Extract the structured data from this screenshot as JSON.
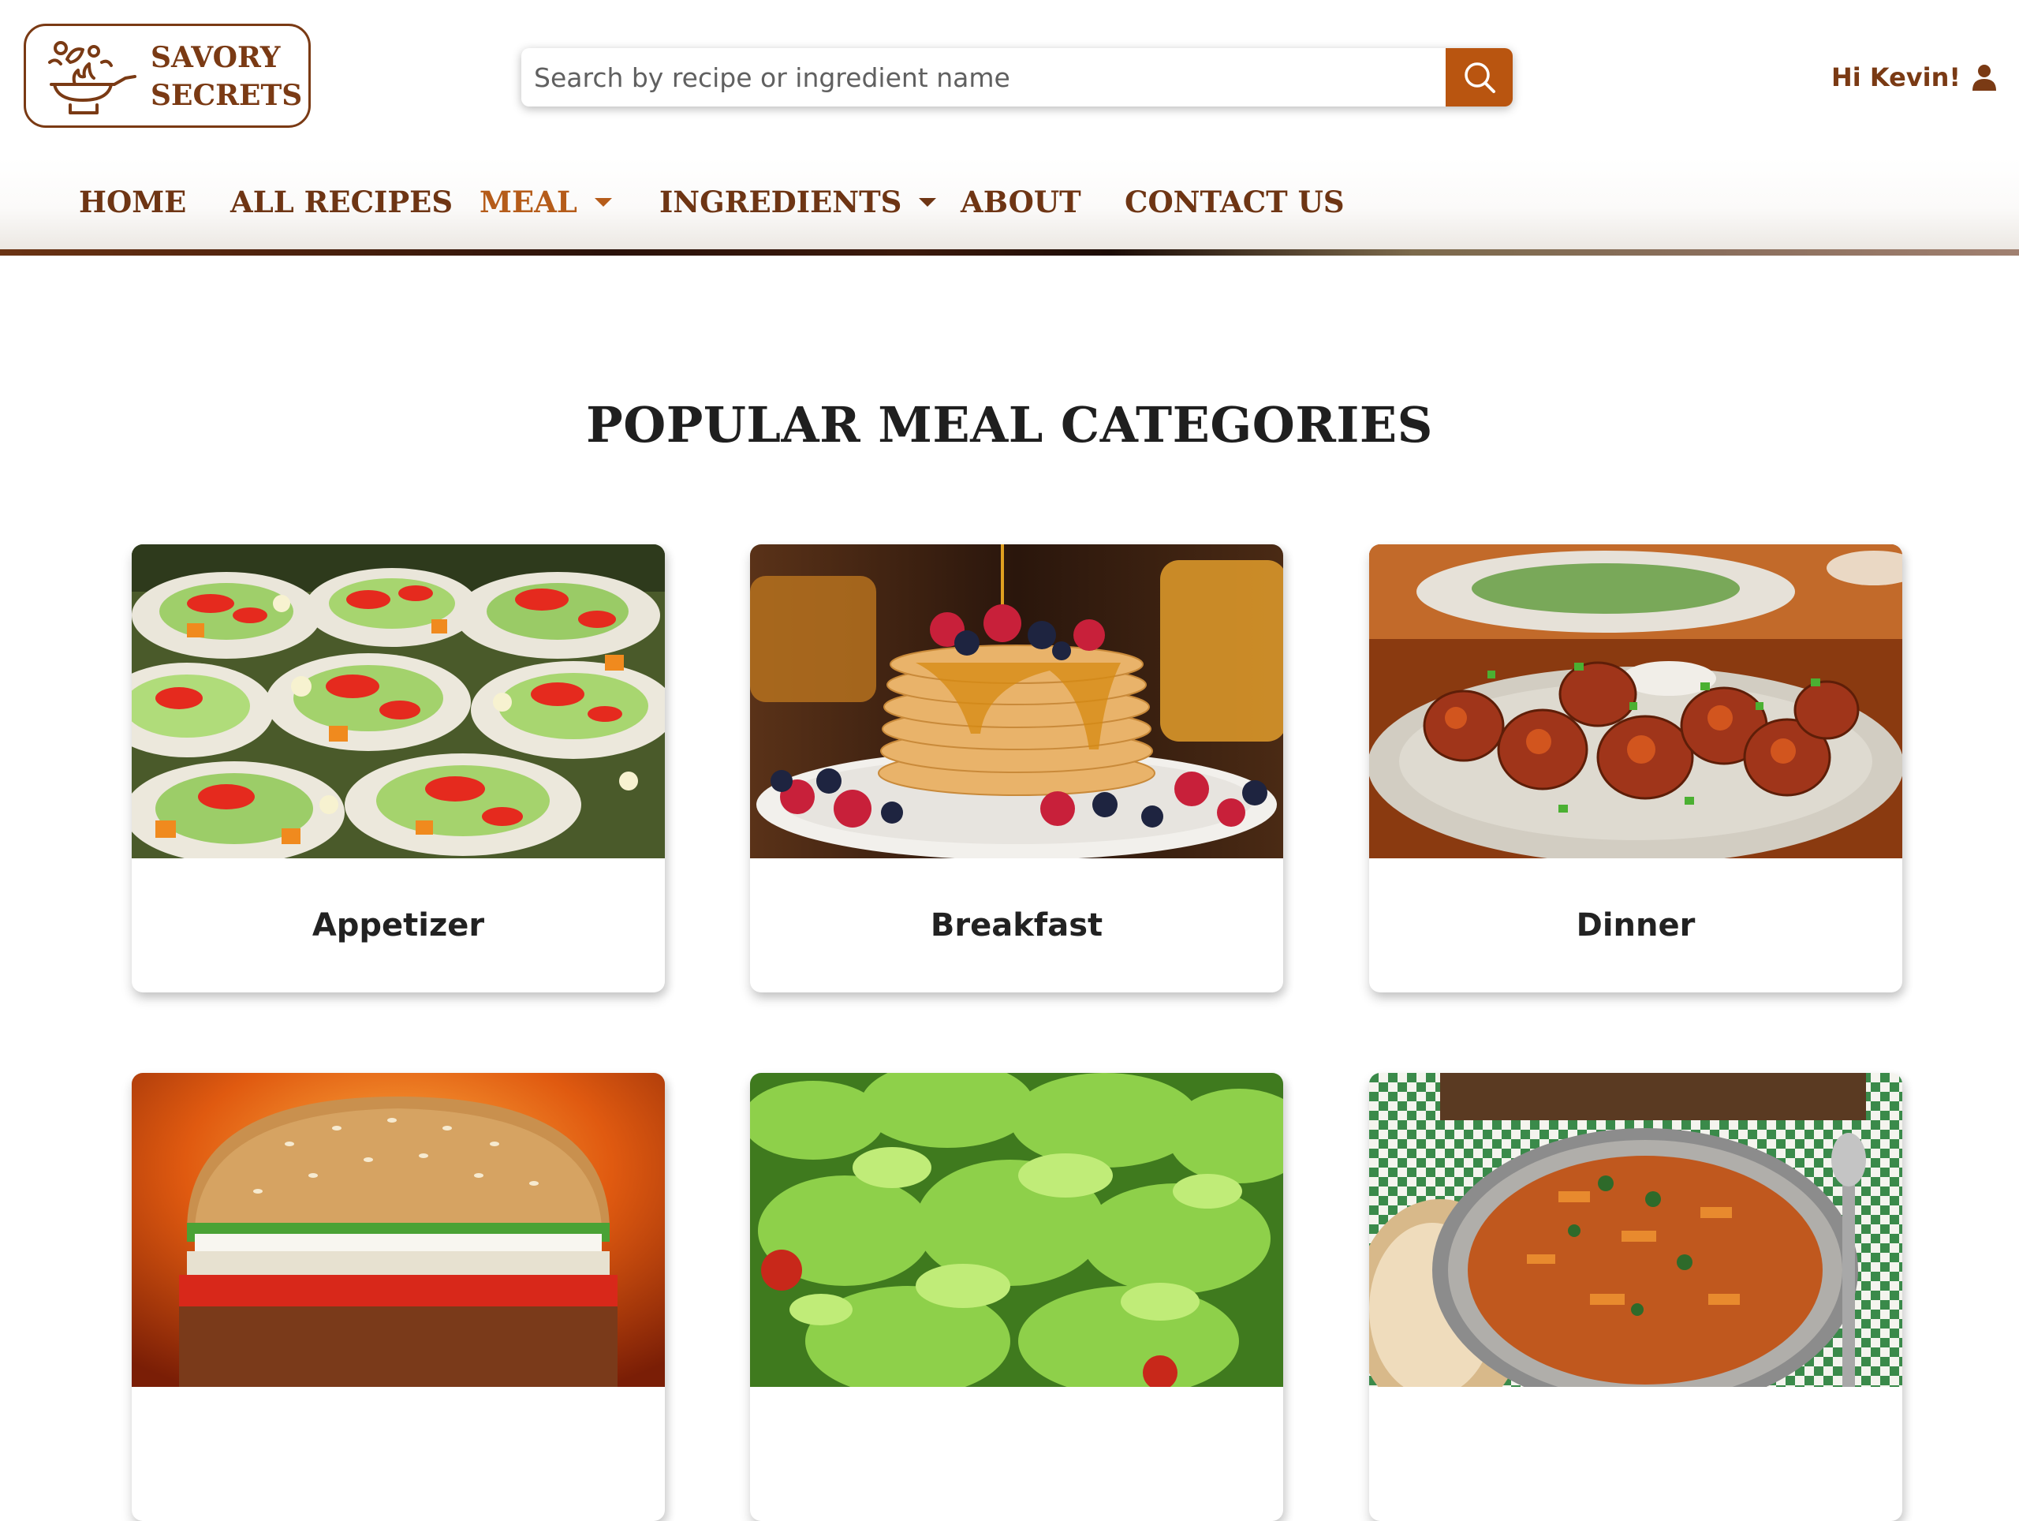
{
  "logo": {
    "line1": "SAVORY",
    "line2": "SECRETS"
  },
  "search": {
    "placeholder": "Search by recipe or ingredient name",
    "value": ""
  },
  "user": {
    "greeting": "Hi Kevin!"
  },
  "nav": {
    "items": [
      {
        "label": "HOME"
      },
      {
        "label": "ALL RECIPES"
      },
      {
        "label": "MEAL",
        "active": true,
        "dropdown": true
      },
      {
        "label": "INGREDIENTS",
        "dropdown": true
      },
      {
        "label": "ABOUT"
      },
      {
        "label": "CONTACT US"
      }
    ]
  },
  "main": {
    "title": "POPULAR MEAL CATEGORIES",
    "cards": [
      {
        "label": "Appetizer"
      },
      {
        "label": "Breakfast"
      },
      {
        "label": "Dinner"
      },
      {
        "label": ""
      },
      {
        "label": ""
      },
      {
        "label": ""
      }
    ]
  },
  "colors": {
    "brand": "#7a3a14",
    "accent": "#b95510",
    "active_nav": "#b55c1a"
  }
}
